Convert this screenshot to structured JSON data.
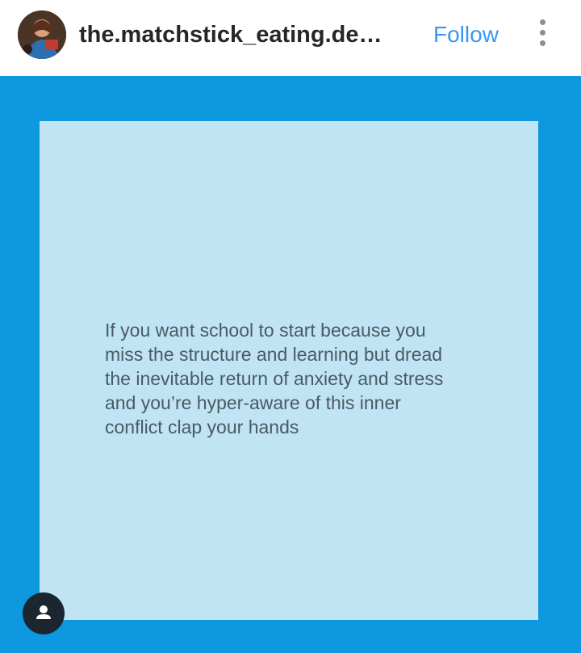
{
  "header": {
    "username": "the.matchstick_eating.demi...",
    "follow_label": "Follow",
    "avatar_icon": "profile-avatar",
    "more_icon": "more-options-icon"
  },
  "post": {
    "background_color": "#0d98df",
    "card_color": "#c0e4f4",
    "text": "If you want school to start because you\nmiss the structure and learning but dread\nthe inevitable return of anxiety and stress\nand you’re hyper-aware of this inner\nconflict clap your hands",
    "tag_icon": "user-tag-icon"
  },
  "colors": {
    "follow": "#3897f0",
    "username": "#262626"
  }
}
